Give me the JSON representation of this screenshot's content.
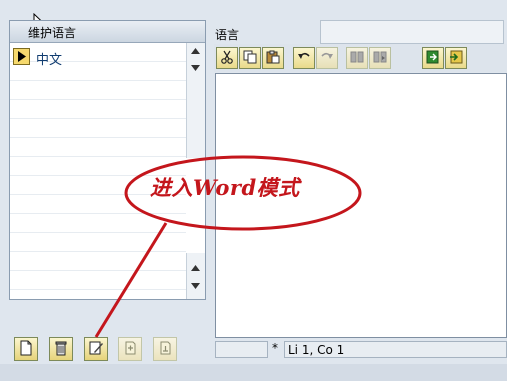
{
  "left_panel": {
    "header": "维护语言",
    "rows": [
      {
        "label": "中文"
      }
    ]
  },
  "right_panel": {
    "tab_label": "语言",
    "toolbar": [
      {
        "icon": "cut-icon",
        "enabled": true
      },
      {
        "icon": "copy-icon",
        "enabled": true
      },
      {
        "icon": "paste-icon",
        "enabled": true
      },
      {
        "icon": "undo-icon",
        "enabled": true
      },
      {
        "icon": "redo-icon",
        "enabled": false
      },
      {
        "icon": "find-icon",
        "enabled": false
      },
      {
        "icon": "find-next-icon",
        "enabled": false
      },
      {
        "icon": "import-icon",
        "enabled": true
      },
      {
        "icon": "export-icon",
        "enabled": true
      }
    ],
    "status": {
      "modified_marker": "*",
      "position": "Li 1, Co 1"
    }
  },
  "bottom_buttons": [
    {
      "icon": "new-document-icon",
      "enabled": true
    },
    {
      "icon": "delete-icon",
      "enabled": true
    },
    {
      "icon": "word-mode-icon",
      "enabled": true
    },
    {
      "icon": "insert-icon",
      "enabled": false
    },
    {
      "icon": "append-icon",
      "enabled": false
    }
  ],
  "annotation": {
    "text": "进入Word模式",
    "color": "#c4161c"
  },
  "colors": {
    "background": "#dfe6ee",
    "button_face": "#f2e6a6",
    "annotation_red": "#c4161c"
  }
}
